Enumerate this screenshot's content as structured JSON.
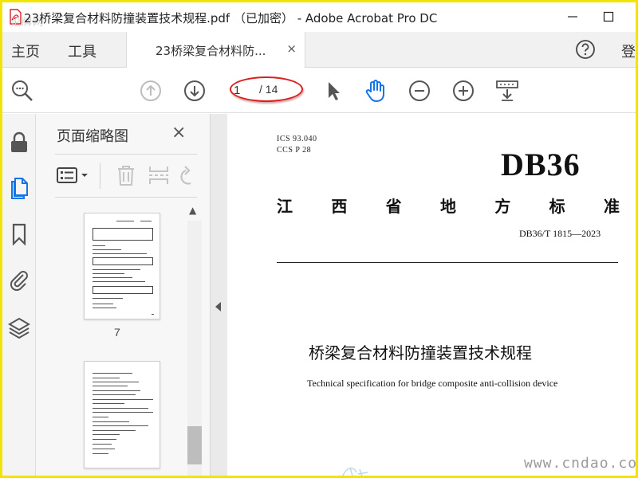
{
  "window": {
    "title": "23桥梁复合材料防撞装置技术规程.pdf （已加密） - Adobe Acrobat Pro DC",
    "watermark": "论牌网",
    "minimize_icon": "minimize-icon",
    "maximize_icon": "maximize-icon"
  },
  "tabbar": {
    "home": "主页",
    "tools": "工具",
    "doc_tab": "23桥梁复合材料防...",
    "doc_tab_close": "×",
    "help_icon": "help-icon",
    "login": "登"
  },
  "toolbar": {
    "page_current": "1",
    "page_total": "/ 14",
    "icons": [
      "zoom-search-icon",
      "page-up-icon",
      "page-down-icon",
      "select-pointer-icon",
      "hand-tool-icon",
      "zoom-out-icon",
      "zoom-in-icon",
      "fit-page-icon"
    ]
  },
  "rail": {
    "icons": [
      "lock-icon",
      "pages-icon",
      "bookmark-icon",
      "attachment-icon",
      "layers-icon"
    ]
  },
  "thumbnails_panel": {
    "title": "页面缩略图",
    "close": "×",
    "thumbnail_label": "7"
  },
  "document": {
    "ics": "ICS 93.040",
    "ccs": "CCS P 28",
    "code_big": "DB36",
    "std_chars": [
      "江",
      "西",
      "省",
      "地",
      "方",
      "标",
      "准"
    ],
    "std_number": "DB36/T 1815—2023",
    "title_zh": "桥梁复合材料防撞装置技术规程",
    "title_en": "Technical specification for bridge composite anti-collision device",
    "watermark": "www.cndao.com"
  },
  "colors": {
    "frame": "#f2e400",
    "accent": "#1473e6",
    "annotation": "#d82020"
  }
}
